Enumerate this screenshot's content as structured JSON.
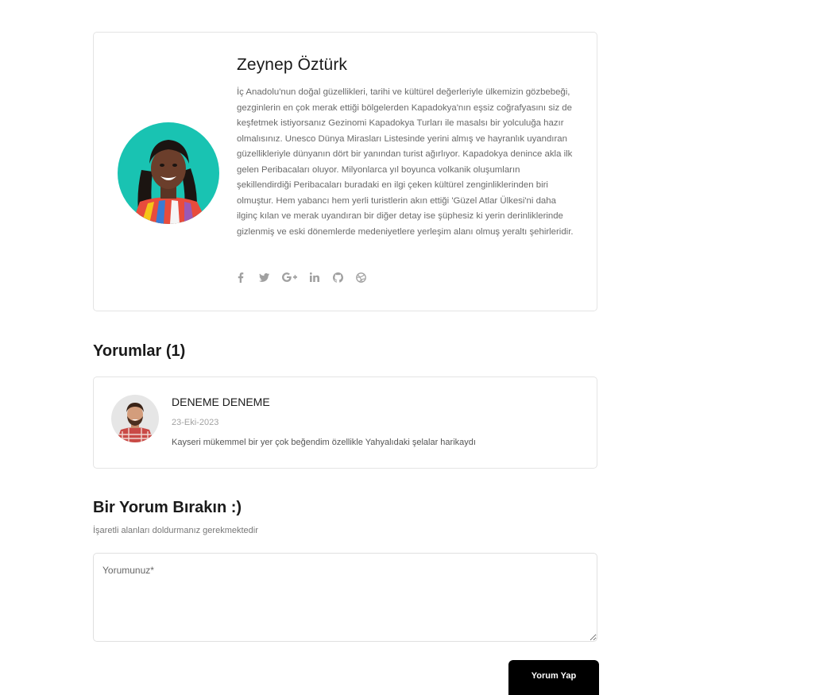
{
  "author": {
    "name": "Zeynep Öztürk",
    "bio": "İç Anadolu'nun doğal güzellikleri, tarihi ve kültürel değerleriyle ülkemizin gözbebeği, gezginlerin en çok merak ettiği bölgelerden Kapadokya'nın eşsiz coğrafyasını siz de keşfetmek istiyorsanız Gezinomi Kapadokya Turları ile masalsı bir yolculuğa hazır olmalısınız. Unesco Dünya Mirasları Listesinde yerini almış ve hayranlık uyandıran güzellikleriyle dünyanın dört bir yanından turist ağırlıyor. Kapadokya denince akla ilk gelen Peribacaları oluyor. Milyonlarca yıl boyunca volkanik oluşumların şekillendirdiği Peribacaları buradaki en ilgi çeken kültürel zenginliklerinden biri olmuştur. Hem yabancı hem yerli turistlerin akın ettiği 'Güzel Atlar Ülkesi'ni daha ilginç kılan ve merak uyandıran bir diğer detay ise şüphesiz ki yerin derinliklerinde gizlenmiş ve eski dönemlerde medeniyetlere yerleşim alanı olmuş yeraltı şehirleridir.",
    "social_icons": [
      "facebook-icon",
      "twitter-icon",
      "google-plus-icon",
      "linkedin-icon",
      "github-icon",
      "dribbble-icon"
    ]
  },
  "comments_section": {
    "title": "Yorumlar (1)",
    "comments": [
      {
        "author": "DENEME DENEME",
        "date": "23-Eki-2023",
        "text": "Kayseri mükemmel bir yer çok beğendim özellikle Yahyalıdaki şelalar harikaydı"
      }
    ]
  },
  "comment_form": {
    "title": "Bir Yorum Bırakın :)",
    "required_note": "İşaretli alanları doldurmanız gerekmektedir",
    "textarea_placeholder": "Yorumunuz*",
    "submit_label": "Yorum Yap"
  },
  "colors": {
    "border": "#e4e4e4",
    "icon": "#999999",
    "button_bg": "#000000",
    "avatar_bg": "#19c3b2"
  }
}
